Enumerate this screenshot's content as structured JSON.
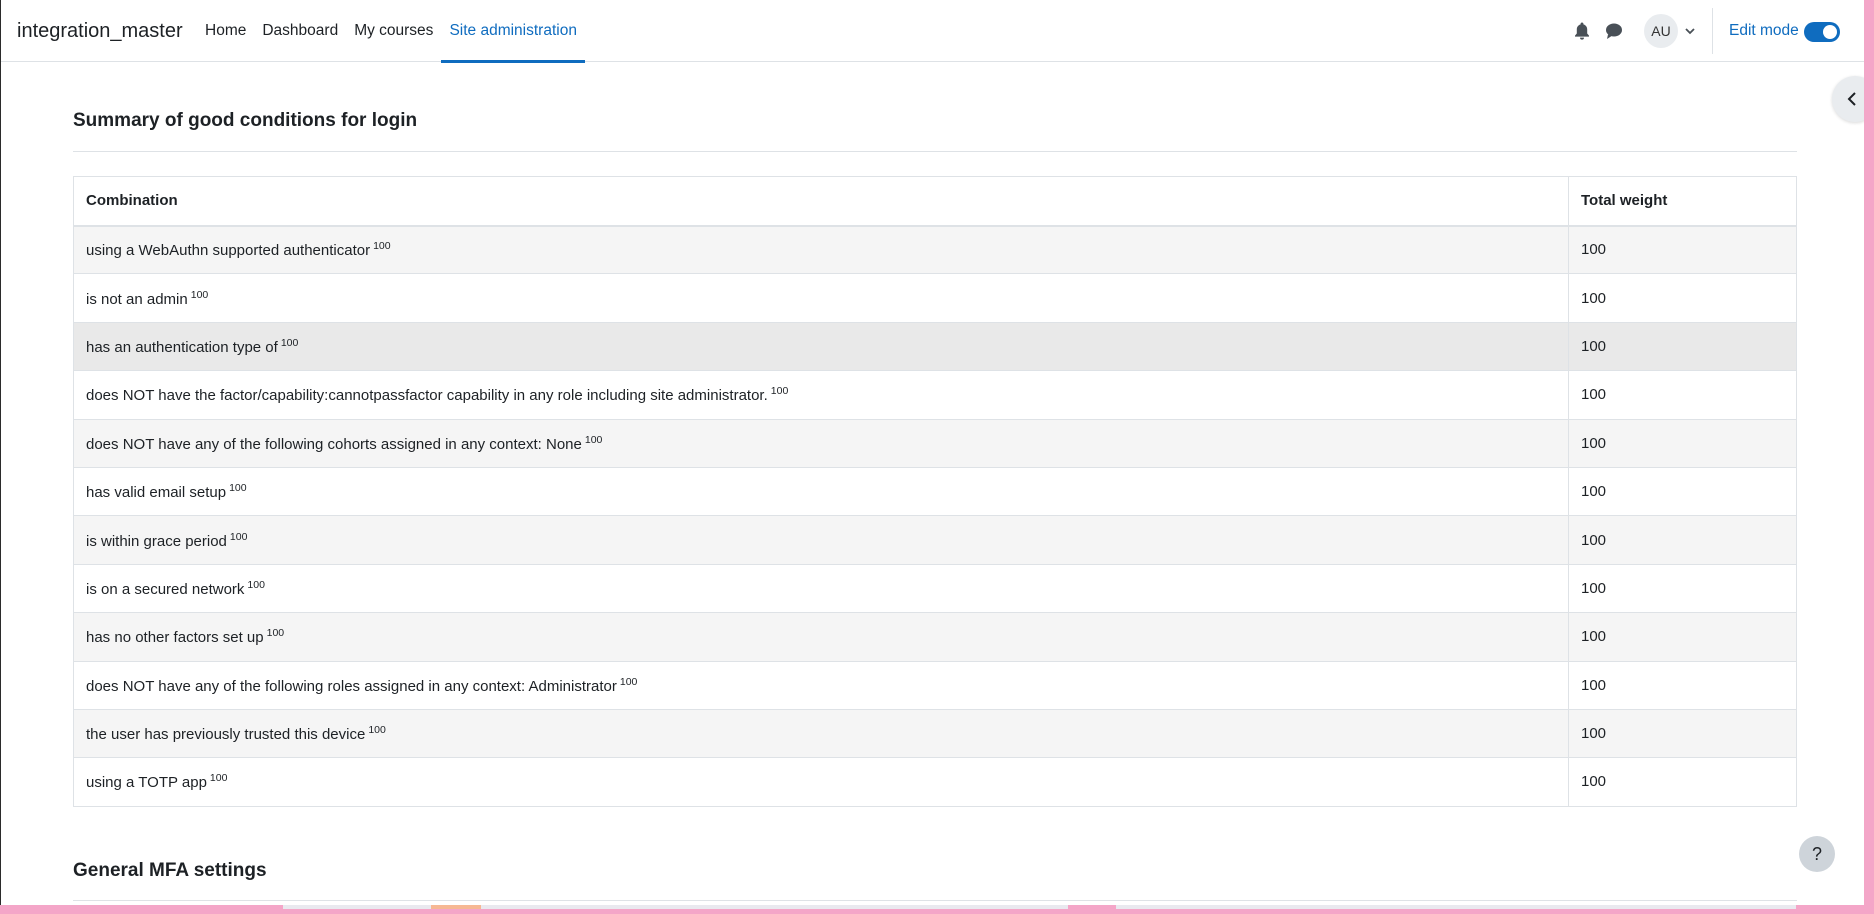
{
  "navbar": {
    "brand": "integration_master",
    "items": [
      {
        "label": "Home",
        "active": false
      },
      {
        "label": "Dashboard",
        "active": false
      },
      {
        "label": "My courses",
        "active": false
      },
      {
        "label": "Site administration",
        "active": true
      }
    ],
    "avatar_initials": "AU",
    "edit_mode_label": "Edit mode",
    "edit_mode_on": true,
    "icons": [
      "bell-icon",
      "chat-icon",
      "chevron-down-icon"
    ]
  },
  "drawer_toggle_icon": "chevron-left-icon",
  "summary": {
    "title": "Summary of good conditions for login",
    "columns": [
      "Combination",
      "Total weight"
    ],
    "rows": [
      {
        "combination": "using a WebAuthn supported authenticator",
        "sup": "100",
        "weight": "100"
      },
      {
        "combination": "is not an admin",
        "sup": "100",
        "weight": "100"
      },
      {
        "combination": "has an authentication type of",
        "sup": "100",
        "weight": "100"
      },
      {
        "combination": "does NOT have the factor/capability:cannotpassfactor capability in any role including site administrator.",
        "sup": "100",
        "weight": "100"
      },
      {
        "combination": "does NOT have any of the following cohorts assigned in any context: None",
        "sup": "100",
        "weight": "100"
      },
      {
        "combination": "has valid email setup",
        "sup": "100",
        "weight": "100"
      },
      {
        "combination": "is within grace period",
        "sup": "100",
        "weight": "100"
      },
      {
        "combination": "is on a secured network",
        "sup": "100",
        "weight": "100"
      },
      {
        "combination": "has no other factors set up",
        "sup": "100",
        "weight": "100"
      },
      {
        "combination": "does NOT have any of the following roles assigned in any context: Administrator",
        "sup": "100",
        "weight": "100"
      },
      {
        "combination": "the user has previously trusted this device",
        "sup": "100",
        "weight": "100"
      },
      {
        "combination": "using a TOTP app",
        "sup": "100",
        "weight": "100"
      }
    ]
  },
  "general_settings_title": "General MFA settings",
  "help_button_label": "?",
  "colors": {
    "accent": "#0f6cbf",
    "text": "#1d2125",
    "border": "#dee2e6",
    "stripe": "#f5f5f5"
  }
}
